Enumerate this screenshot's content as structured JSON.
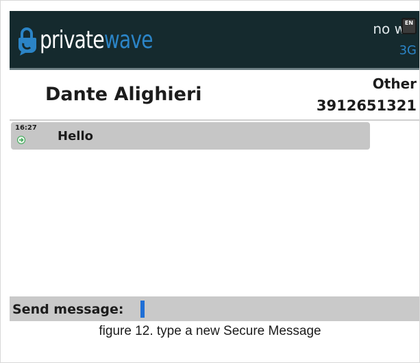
{
  "app": {
    "logo_part1": "private",
    "logo_part2": "wave",
    "network_status": "no w",
    "network_type": "3G",
    "language_badge": "EN",
    "brand_dark": "#152a2e",
    "brand_accent": "#2b84c6",
    "logo_icon": "lock-bubble-icon"
  },
  "contact": {
    "name": "Dante Alighieri",
    "type": "Other",
    "number": "3912651321"
  },
  "messages": [
    {
      "time": "16:27",
      "text": "Hello",
      "status_icon": "sent-arrow-icon",
      "status_color": "#3aa655"
    }
  ],
  "compose": {
    "label": "Send message:",
    "value": "",
    "cursor_color": "#1f6fd6"
  },
  "caption": "figure 12. type a new Secure Message"
}
